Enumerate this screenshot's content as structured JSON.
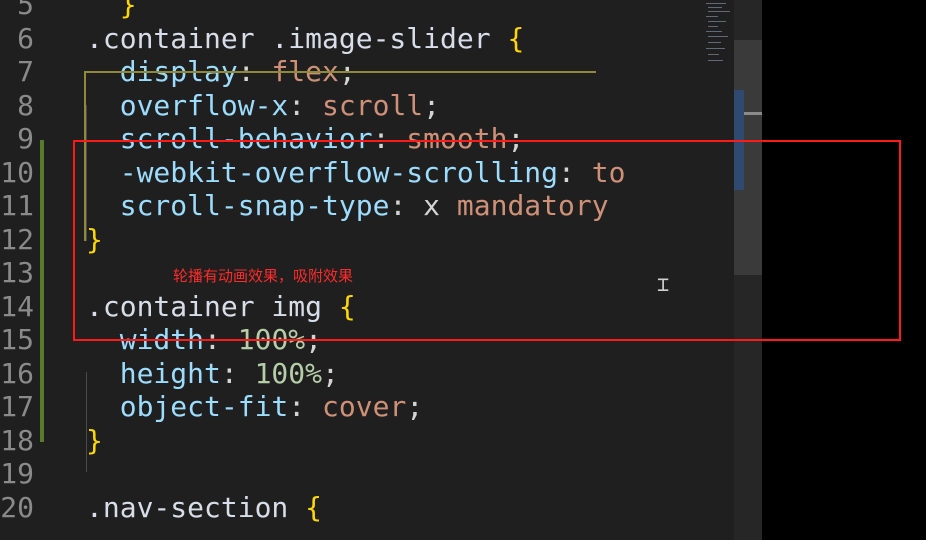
{
  "editor": {
    "lines": [
      {
        "num": "5",
        "tokens": [
          {
            "t": "brace",
            "v": "  }"
          }
        ]
      },
      {
        "num": "6",
        "tokens": [
          {
            "t": "sel",
            "v": ".container .image-slider "
          },
          {
            "t": "brace",
            "v": "{"
          }
        ]
      },
      {
        "num": "7",
        "tokens": [
          {
            "t": "prop",
            "v": "  display"
          },
          {
            "t": "punc",
            "v": ": "
          },
          {
            "t": "val",
            "v": "flex"
          },
          {
            "t": "punc",
            "v": ";"
          }
        ]
      },
      {
        "num": "8",
        "tokens": [
          {
            "t": "prop",
            "v": "  overflow-x"
          },
          {
            "t": "punc",
            "v": ": "
          },
          {
            "t": "val",
            "v": "scroll"
          },
          {
            "t": "punc",
            "v": ";"
          }
        ]
      },
      {
        "num": "9",
        "tokens": [
          {
            "t": "prop",
            "v": "  scroll-behavior"
          },
          {
            "t": "punc",
            "v": ": "
          },
          {
            "t": "val",
            "v": "smooth"
          },
          {
            "t": "punc",
            "v": ";"
          }
        ]
      },
      {
        "num": "10",
        "tokens": [
          {
            "t": "prop",
            "v": "  -webkit-overflow-scrolling"
          },
          {
            "t": "punc",
            "v": ": "
          },
          {
            "t": "val",
            "v": "to"
          }
        ]
      },
      {
        "num": "11",
        "tokens": [
          {
            "t": "prop",
            "v": "  scroll-snap-type"
          },
          {
            "t": "punc",
            "v": ": "
          },
          {
            "t": "plain",
            "v": "x "
          },
          {
            "t": "val",
            "v": "mandatory"
          }
        ]
      },
      {
        "num": "12",
        "tokens": [
          {
            "t": "brace",
            "v": "}"
          }
        ]
      },
      {
        "num": "13",
        "tokens": []
      },
      {
        "num": "14",
        "tokens": [
          {
            "t": "sel",
            "v": ".container img "
          },
          {
            "t": "brace",
            "v": "{"
          }
        ]
      },
      {
        "num": "15",
        "tokens": [
          {
            "t": "prop",
            "v": "  width"
          },
          {
            "t": "punc",
            "v": ": "
          },
          {
            "t": "num",
            "v": "100%"
          },
          {
            "t": "punc",
            "v": ";"
          }
        ]
      },
      {
        "num": "16",
        "tokens": [
          {
            "t": "prop",
            "v": "  height"
          },
          {
            "t": "punc",
            "v": ": "
          },
          {
            "t": "num",
            "v": "100%"
          },
          {
            "t": "punc",
            "v": ";"
          }
        ]
      },
      {
        "num": "17",
        "tokens": [
          {
            "t": "prop",
            "v": "  object-fit"
          },
          {
            "t": "punc",
            "v": ": "
          },
          {
            "t": "val",
            "v": "cover"
          },
          {
            "t": "punc",
            "v": ";"
          }
        ]
      },
      {
        "num": "18",
        "tokens": [
          {
            "t": "brace",
            "v": "}"
          }
        ]
      },
      {
        "num": "19",
        "tokens": []
      },
      {
        "num": "20",
        "tokens": [
          {
            "t": "sel",
            "v": ".nav-section "
          },
          {
            "t": "brace",
            "v": "{"
          }
        ]
      }
    ]
  },
  "annotation": {
    "text": "轮播有动画效果，吸附效果",
    "color": "#ff2a2a"
  },
  "colors": {
    "editor_bg": "#1f1f1f",
    "selector": "#d8dee9",
    "brace": "#ffd700",
    "property": "#9cdcfe",
    "value": "#ce9178",
    "number": "#b5cea8",
    "highlight_box": "#ff1a1a",
    "git_modified": "#587c2d"
  },
  "icons": {
    "cursor": "text-cursor-icon"
  }
}
